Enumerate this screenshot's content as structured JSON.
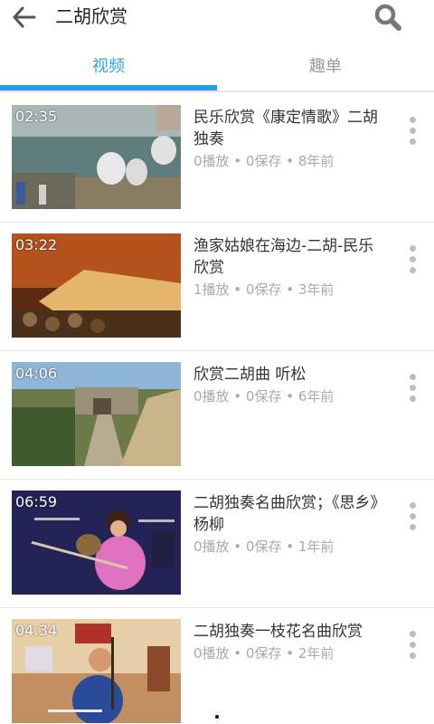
{
  "header": {
    "title": "二胡欣赏",
    "back_icon": "arrow-left-icon",
    "search_icon": "search-icon"
  },
  "tabs": [
    {
      "label": "视频",
      "active": true
    },
    {
      "label": "趣单",
      "active": false
    }
  ],
  "colors": {
    "accent": "#2a9be0",
    "active_tab_text": "#33a6e0",
    "inactive_tab_text": "#9a9a9a",
    "meta_text": "#aaaaaa"
  },
  "videos": [
    {
      "duration": "02:35",
      "title": "民乐欣赏《康定情歌》二胡独奏",
      "meta": "0播放 • 0保存 • 8年前"
    },
    {
      "duration": "03:22",
      "title": "渔家姑娘在海边-二胡-民乐欣赏",
      "meta": "1播放 • 0保存 • 3年前"
    },
    {
      "duration": "04:06",
      "title": "欣赏二胡曲 听松",
      "meta": "0播放 • 0保存 • 6年前"
    },
    {
      "duration": "06:59",
      "title": "二胡独奏名曲欣赏；《思乡》杨柳",
      "meta": "0播放 • 0保存 • 1年前"
    },
    {
      "duration": "04:34",
      "title": "二胡独奏一枝花名曲欣赏",
      "meta": "0播放 • 0保存 • 2年前"
    }
  ],
  "more_icon": "more-vertical-icon"
}
